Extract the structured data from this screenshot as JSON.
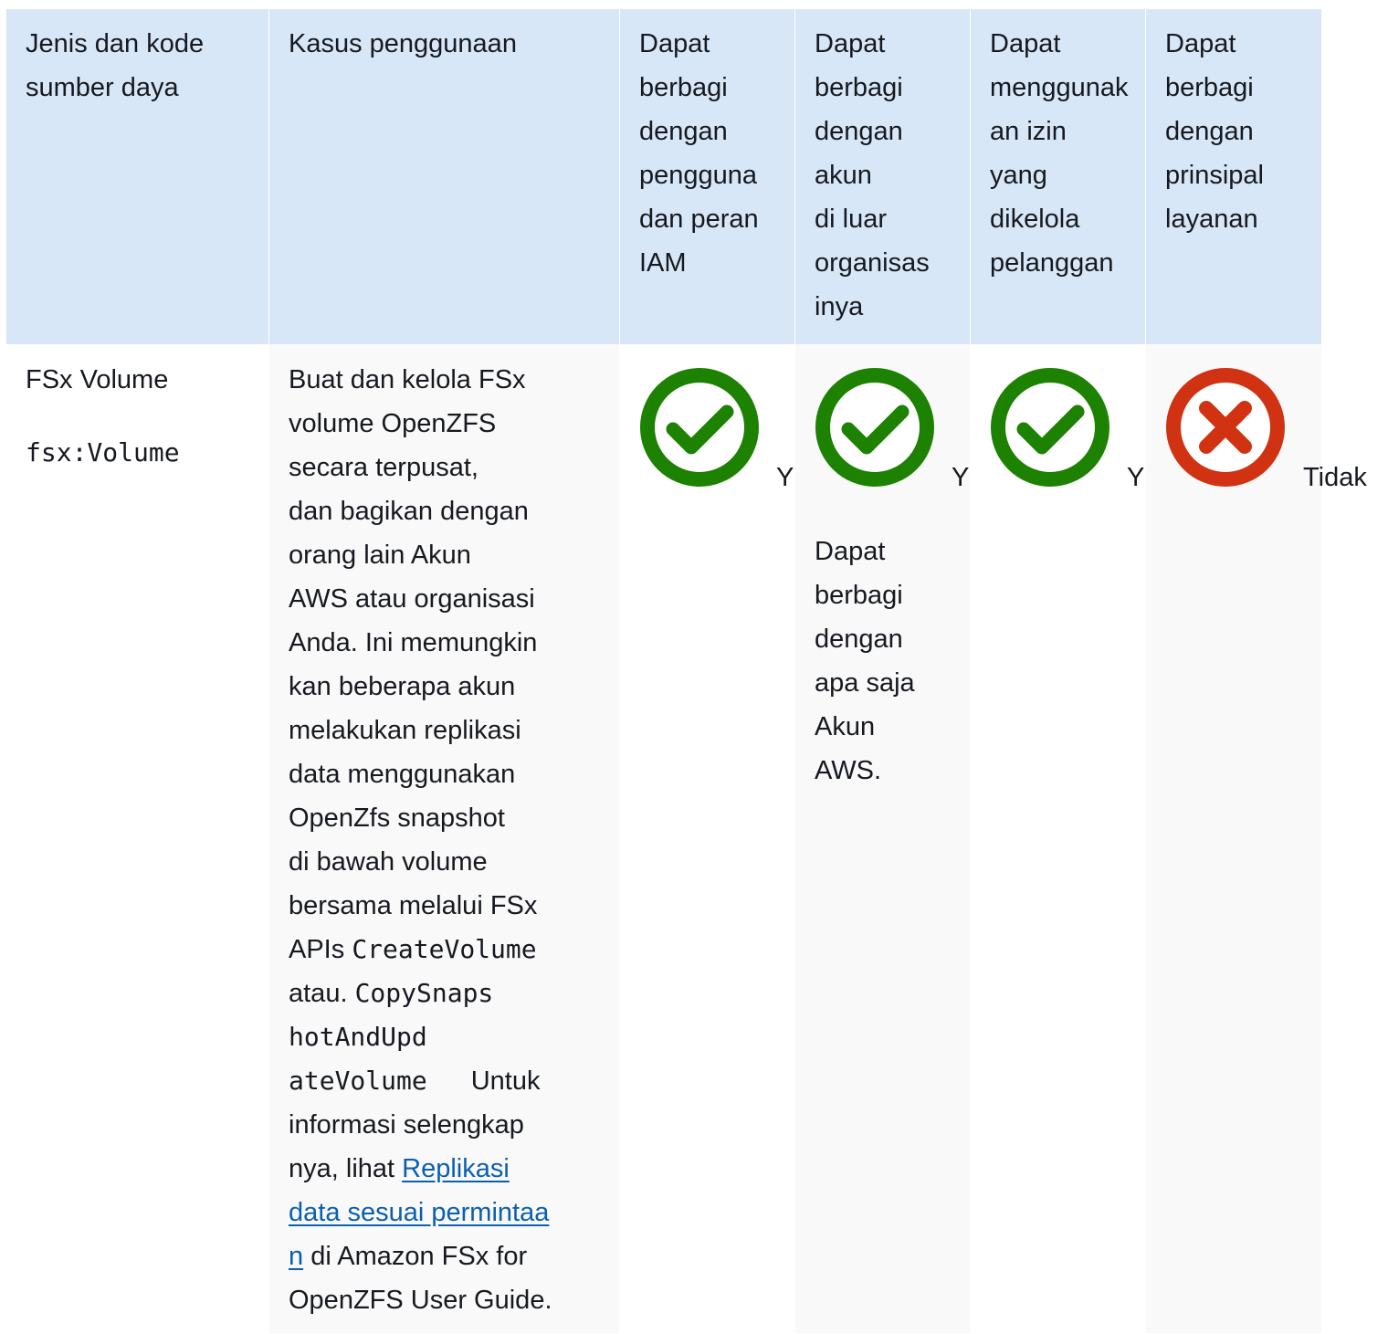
{
  "headers": [
    [
      "Jenis dan kode",
      "sumber daya"
    ],
    [
      "Kasus penggunaan"
    ],
    [
      "Dapat",
      "berbagi",
      "dengan",
      "pengguna",
      "dan peran",
      "IAM"
    ],
    [
      "Dapat",
      "berbagi",
      "dengan",
      "akun",
      "di luar",
      "organisas",
      "inya"
    ],
    [
      "Dapat",
      "menggunak",
      "an izin",
      "yang",
      "dikelola",
      "pelanggan"
    ],
    [
      "Dapat",
      "berbagi",
      "dengan",
      "prinsipal",
      "layanan"
    ]
  ],
  "row": {
    "resource_name": "FSx Volume",
    "resource_code": "fsx:Volume",
    "use_case": {
      "lines": [
        "Buat dan kelola FSx",
        "volume OpenZFS",
        "secara terpusat,",
        "dan bagikan dengan",
        "orang lain Akun",
        "AWS atau organisasi",
        "Anda. Ini memungkin",
        "kan beberapa akun",
        "melakukan replikasi",
        "data menggunakan",
        "OpenZfs snapshot",
        "di bawah volume",
        "bersama melalui FSx"
      ],
      "apis_prefix": "APIs ",
      "api_create": "CreateVolume",
      "atau_prefix": "atau. ",
      "api_copy_1": "CopySnaps",
      "api_copy_2": "hotAndUpd",
      "api_copy_3": "ateVolume",
      "untuk": "Untuk",
      "info_1": "informasi selengkap",
      "info_2": "nya, lihat ",
      "link_1": "Replikasi",
      "link_2": "data sesuai permintaa",
      "link_3": "n",
      "after_link": " di Amazon FSx for",
      "last_line": "OpenZFS User Guide."
    },
    "iam_share": {
      "icon": "check-circle-icon",
      "value": "Y"
    },
    "outside_org": {
      "icon": "check-circle-icon",
      "value": "Y",
      "note": [
        "Dapat",
        "berbagi",
        "dengan",
        "apa saja",
        "Akun",
        "AWS."
      ]
    },
    "customer_managed": {
      "icon": "check-circle-icon",
      "value": "Y"
    },
    "service_principal": {
      "icon": "x-circle-icon",
      "value": "Tidak"
    }
  },
  "colors": {
    "header_bg": "#d8e7f7",
    "check": "#1d8102",
    "cross": "#d13212",
    "link": "#0b5fb0"
  }
}
